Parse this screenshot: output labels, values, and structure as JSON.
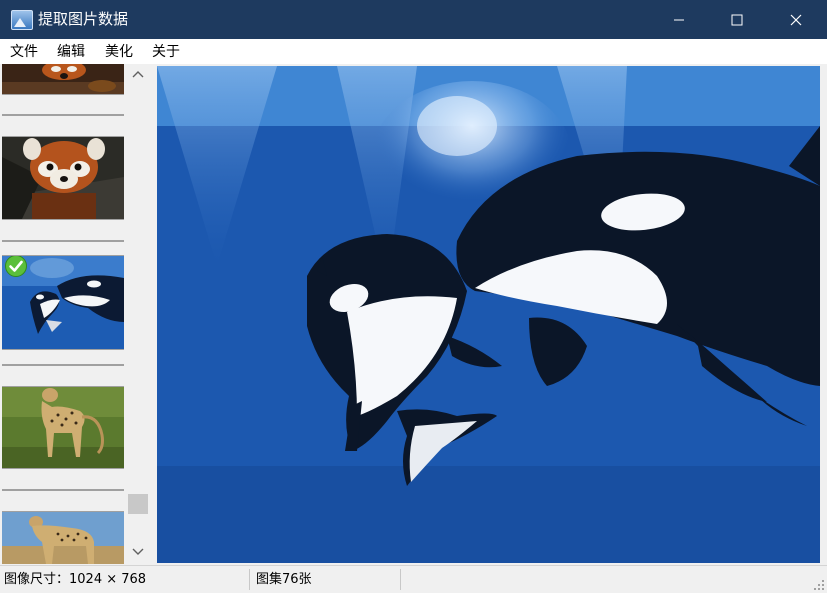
{
  "window": {
    "title": "提取图片数据",
    "minimize_icon": "minimize-icon",
    "maximize_icon": "maximize-icon",
    "close_icon": "close-icon"
  },
  "menu": [
    "文件",
    "编辑",
    "美化",
    "关于"
  ],
  "sidebar": {
    "thumbnails": [
      {
        "subject": "red panda (partially scrolled)",
        "selected": false
      },
      {
        "subject": "red panda",
        "selected": false
      },
      {
        "subject": "orca whales",
        "selected": true,
        "badge_icon": "checkmark-badge-icon"
      },
      {
        "subject": "cheetah on grass",
        "selected": false
      },
      {
        "subject": "cheetah standing",
        "selected": false
      }
    ]
  },
  "scrollbar": {
    "up_icon": "chevron-up-icon",
    "down_icon": "chevron-down-icon"
  },
  "viewer": {
    "image_subject": "two orca whales underwater"
  },
  "status": {
    "size_label": "图像尺寸：1024 × 768",
    "count_label": "图集76张"
  },
  "colors": {
    "titlebar": "#1e3a5f",
    "menubar": "#ffffff",
    "chrome": "#f0f0f0",
    "water": "#1b59b3"
  }
}
